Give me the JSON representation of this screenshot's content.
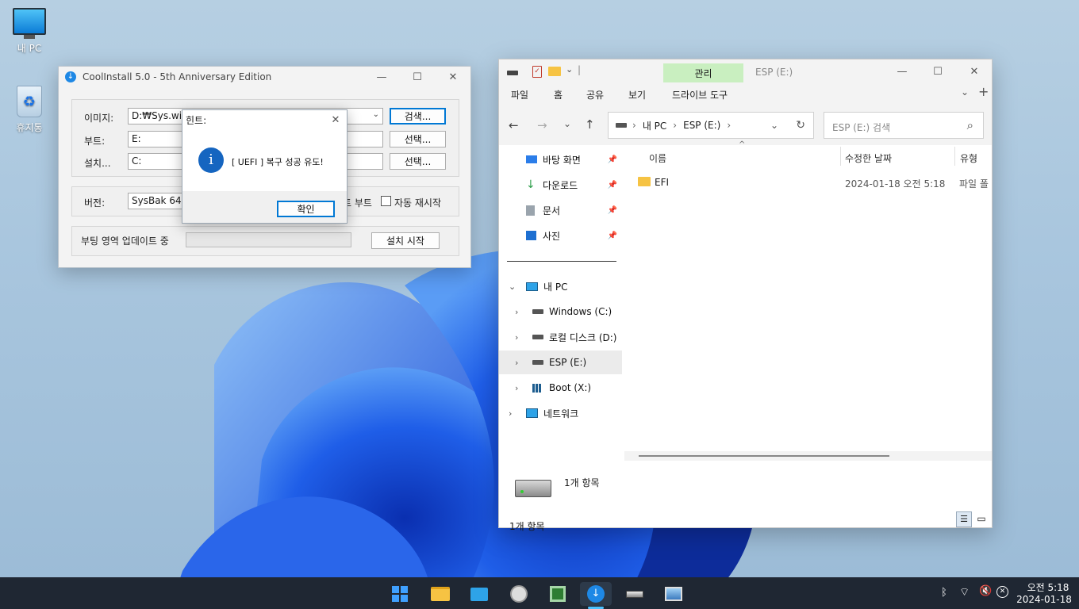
{
  "desktop": {
    "icons": [
      {
        "label": "내 PC",
        "icon": "monitor-icon"
      },
      {
        "label": "휴지통",
        "icon": "recycle-bin-icon"
      }
    ]
  },
  "coolinstall": {
    "title": "CoolInstall 5.0 - 5th Anniversary Edition",
    "image_label": "이미지:",
    "image_value": "D:₩Sys.wim",
    "search_button": "검색...",
    "boot_label": "부트:",
    "boot_value": "E:",
    "boot_select": "선택...",
    "install_label": "설치...",
    "install_value": "C:",
    "install_select": "선택...",
    "version_label": "버전:",
    "version_value": "SysBak  64-",
    "boot_option_partial": "트 부트",
    "auto_restart_label": "자동 재시작",
    "status_text": "부팅 영역 업데이트 중",
    "start_button": "설치 시작",
    "progress": 0
  },
  "dialog": {
    "title": "힌트:",
    "message": "[ UEFI ] 복구 성공 유도!",
    "ok_button": "확인"
  },
  "explorer": {
    "ribbon_manage": "관리",
    "window_title": "ESP (E:)",
    "menu": [
      "파일",
      "홈",
      "공유",
      "보기",
      "드라이브 도구"
    ],
    "breadcrumb": [
      "내 PC",
      "ESP (E:)"
    ],
    "search_placeholder": "ESP (E:) 검색",
    "quick_access": [
      {
        "label": "바탕 화면",
        "icon": "desktop-icon"
      },
      {
        "label": "다운로드",
        "icon": "download-icon"
      },
      {
        "label": "문서",
        "icon": "document-icon"
      },
      {
        "label": "사진",
        "icon": "pictures-icon"
      }
    ],
    "this_pc": "내 PC",
    "drives": [
      "Windows (C:)",
      "로컬 디스크 (D:)",
      "ESP (E:)",
      "Boot (X:)"
    ],
    "network": "네트워크",
    "columns": {
      "name": "이름",
      "date": "수정한 날짜",
      "type": "유형"
    },
    "files": [
      {
        "name": "EFI",
        "date": "2024-01-18 오전 5:18",
        "type": "파일 폴"
      }
    ],
    "details_count": "1개 항목",
    "status_count": "1개 항목"
  },
  "taskbar": {
    "apps": [
      "start-icon",
      "file-explorer-icon",
      "monitor-app-icon",
      "avatar-app-icon",
      "chip-app-icon",
      "coolinstall-app-icon",
      "drive-app-icon",
      "image-app-icon"
    ],
    "time": "오전 5:18",
    "date": "2024-01-18"
  }
}
